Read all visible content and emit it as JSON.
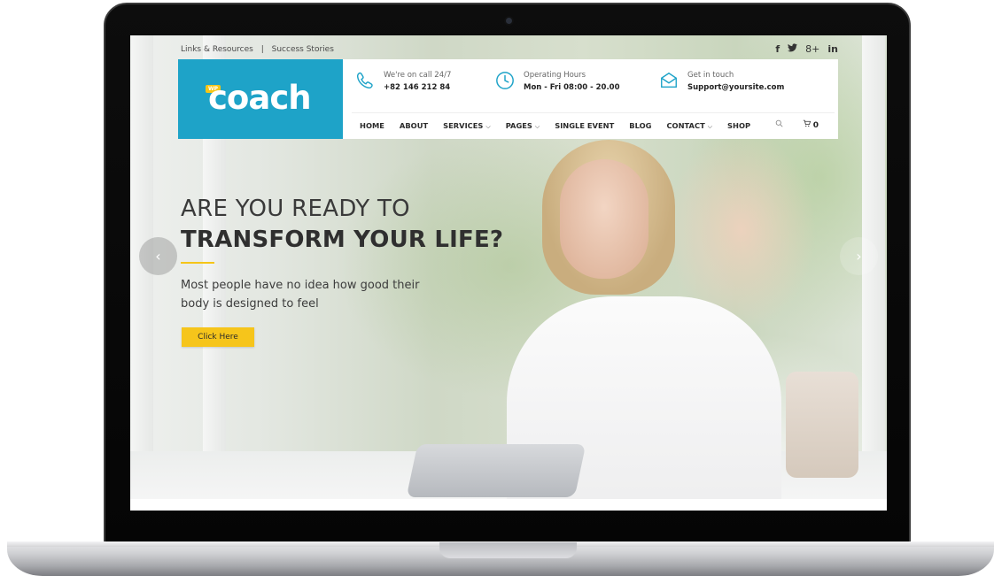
{
  "topbar": {
    "link1": "Links & Resources",
    "separator": "|",
    "link2": "Success Stories"
  },
  "social": [
    "f",
    "🐦",
    "8+",
    "in"
  ],
  "logo": {
    "badge": "WP",
    "text": "coach",
    "bg_color": "#1ea3c8"
  },
  "contact": {
    "call_label": "We're on call 24/7",
    "call_value": "+82 146 212 84",
    "hours_label": "Operating Hours",
    "hours_value": "Mon - Fri 08:00 - 20.00",
    "touch_label": "Get in touch",
    "touch_value": "Support@yoursite.com"
  },
  "nav": {
    "items": [
      "HOME",
      "ABOUT",
      "SERVICES",
      "PAGES",
      "SINGLE EVENT",
      "BLOG",
      "CONTACT",
      "SHOP"
    ],
    "cart_count": "0"
  },
  "hero": {
    "line1": "ARE YOU READY TO",
    "line2": "TRANSFORM YOUR LIFE?",
    "subtitle": "Most people have no idea how good their body is designed to feel",
    "cta": "Click Here",
    "accent_color": "#f5c518"
  },
  "slider": {
    "prev": "‹",
    "next": "›"
  }
}
